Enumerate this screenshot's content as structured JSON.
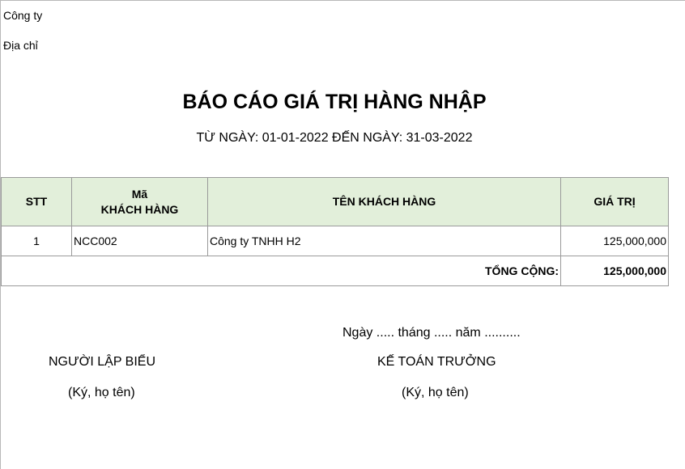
{
  "header": {
    "company_label": "Công ty",
    "address_label": "Địa chỉ"
  },
  "report": {
    "title": "BÁO CÁO GIÁ TRỊ HÀNG NHẬP",
    "date_range": "TỪ NGÀY: 01-01-2022 ĐẾN NGÀY: 31-03-2022"
  },
  "table": {
    "columns": {
      "stt": "STT",
      "code_line1": "Mã",
      "code_line2": "KHÁCH HÀNG",
      "name": "TÊN KHÁCH HÀNG",
      "value": "GIÁ TRỊ"
    },
    "rows": [
      {
        "stt": "1",
        "code": "NCC002",
        "name": "Công ty TNHH H2",
        "value": "125,000,000"
      }
    ],
    "total_label": "TỔNG CỘNG:",
    "total_value": "125,000,000"
  },
  "footer": {
    "date_line": "Ngày ..... tháng ..... năm ..........",
    "left_title": "NGƯỜI LẬP BIỂU",
    "left_note": "(Ký, họ tên)",
    "right_title": "KẾ TOÁN TRƯỞNG",
    "right_note": "(Ký, họ tên)"
  }
}
